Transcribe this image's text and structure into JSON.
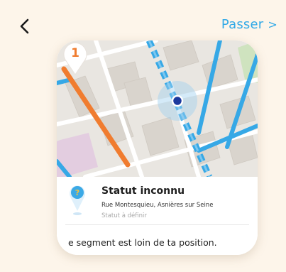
{
  "nav": {
    "back_icon": "chevron-left-icon",
    "skip_label": "Passer",
    "skip_chevron": ">"
  },
  "map": {
    "step_badge": "1",
    "colors": {
      "highlight_blue": "#36a8e6",
      "orange_segment": "#f07c2f",
      "position_dot": "#1c3a9e",
      "badge_orange": "#f07c2f"
    }
  },
  "segment": {
    "status_icon": "question-location-pin-icon",
    "title": "Statut inconnu",
    "address": "Rue Montesquieu, Asnières sur Seine",
    "status": "Statut à définir",
    "message": "e segment est loin de ta position."
  }
}
